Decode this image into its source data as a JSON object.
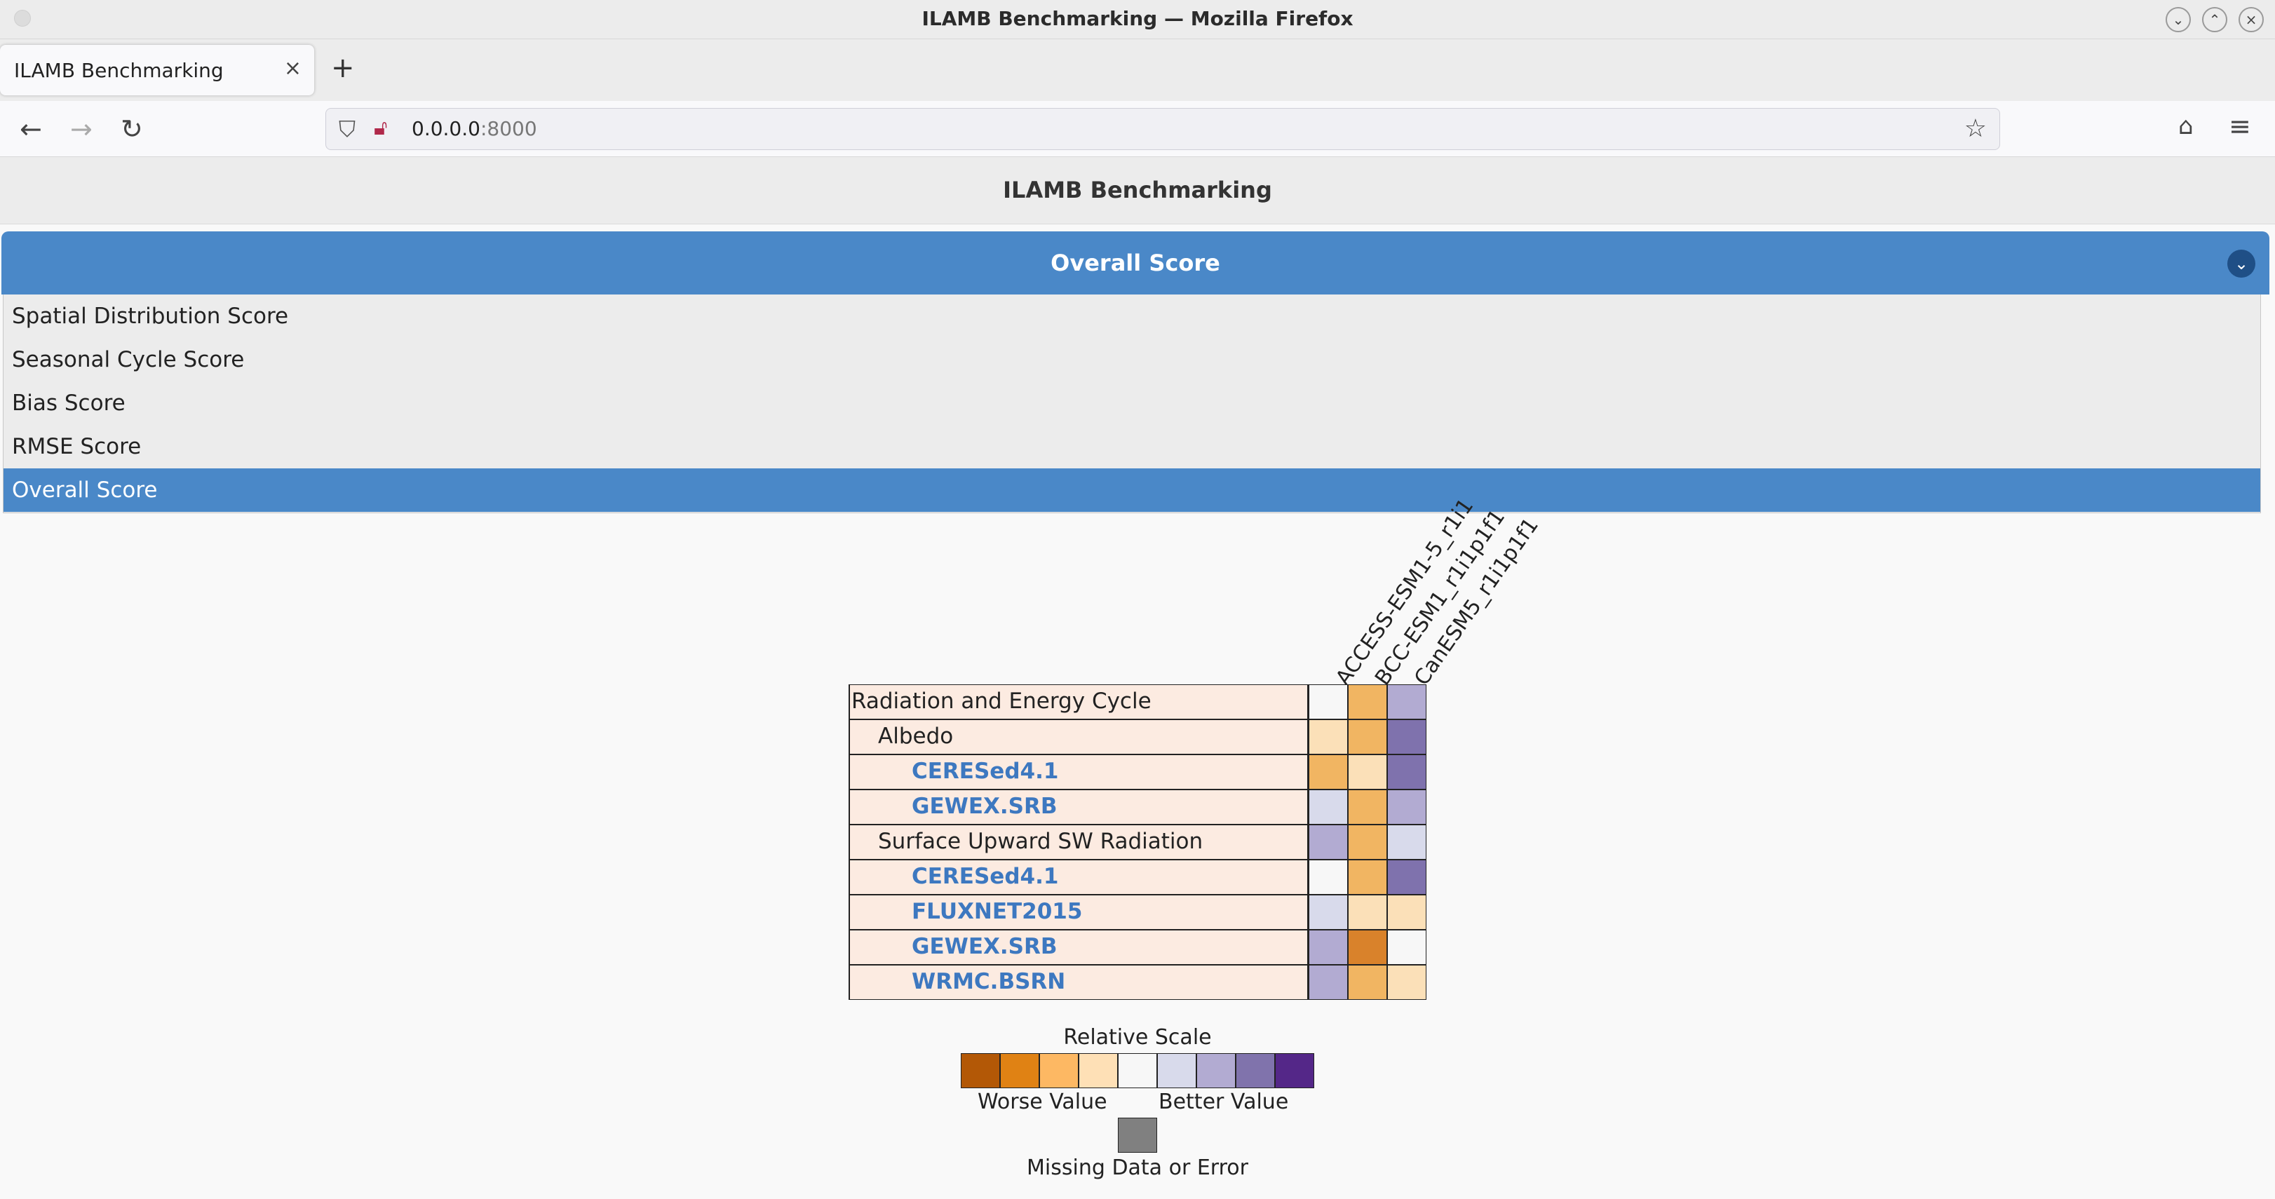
{
  "window": {
    "title": "ILAMB Benchmarking — Mozilla Firefox"
  },
  "tab": {
    "label": "ILAMB Benchmarking",
    "close": "×",
    "new_tab": "+"
  },
  "nav": {
    "back": "←",
    "forward": "→",
    "reload": "↻",
    "url_host": "0.0.0.0",
    "url_port": ":8000",
    "star": "☆",
    "pocket": "⌂",
    "menu": "≡"
  },
  "page": {
    "title": "ILAMB Benchmarking",
    "selector": {
      "selected": "Overall Score",
      "options": [
        "Spatial Distribution Score",
        "Seasonal Cycle Score",
        "Bias Score",
        "RMSE Score",
        "Overall Score"
      ]
    }
  },
  "table": {
    "models": [
      "ACCESS-ESM1-5_r1i1",
      "BCC-ESM1_r1i1p1f1",
      "CanESM5_r1i1p1f1"
    ],
    "rows": [
      {
        "label": "Radiation and Energy Cycle",
        "level": 0,
        "link": false,
        "colors": [
          "#f7f7f7",
          "#f1b562",
          "#b2abd2"
        ]
      },
      {
        "label": "Albedo",
        "level": 1,
        "link": false,
        "colors": [
          "#fbe0b8",
          "#f1b562",
          "#7f72ad"
        ]
      },
      {
        "label": "CERESed4.1",
        "level": 2,
        "link": true,
        "colors": [
          "#f1b562",
          "#fbe0b8",
          "#7f72ad"
        ]
      },
      {
        "label": "GEWEX.SRB",
        "level": 2,
        "link": true,
        "colors": [
          "#d8daeb",
          "#f1b562",
          "#b2abd2"
        ]
      },
      {
        "label": "Surface Upward SW Radiation",
        "level": 1,
        "link": false,
        "colors": [
          "#b2abd2",
          "#f1b562",
          "#d8daeb"
        ]
      },
      {
        "label": "CERESed4.1",
        "level": 2,
        "link": true,
        "colors": [
          "#f7f7f7",
          "#f1b562",
          "#7f72ad"
        ]
      },
      {
        "label": "FLUXNET2015",
        "level": 2,
        "link": true,
        "colors": [
          "#d8daeb",
          "#fbe0b8",
          "#fbe0b8"
        ]
      },
      {
        "label": "GEWEX.SRB",
        "level": 2,
        "link": true,
        "colors": [
          "#b2abd2",
          "#d9822b",
          "#f7f7f7"
        ]
      },
      {
        "label": "WRMC.BSRN",
        "level": 2,
        "link": true,
        "colors": [
          "#b2abd2",
          "#f1b562",
          "#fbe0b8"
        ]
      }
    ]
  },
  "legend": {
    "title": "Relative Scale",
    "colors": [
      "#b35806",
      "#e08214",
      "#fdb863",
      "#fee0b6",
      "#f7f7f7",
      "#d8daeb",
      "#b2abd2",
      "#8073ac",
      "#542788"
    ],
    "worse_label": "Worse Value",
    "better_label": "Better Value",
    "missing_color": "#808080",
    "missing_label": "Missing Data or Error"
  }
}
